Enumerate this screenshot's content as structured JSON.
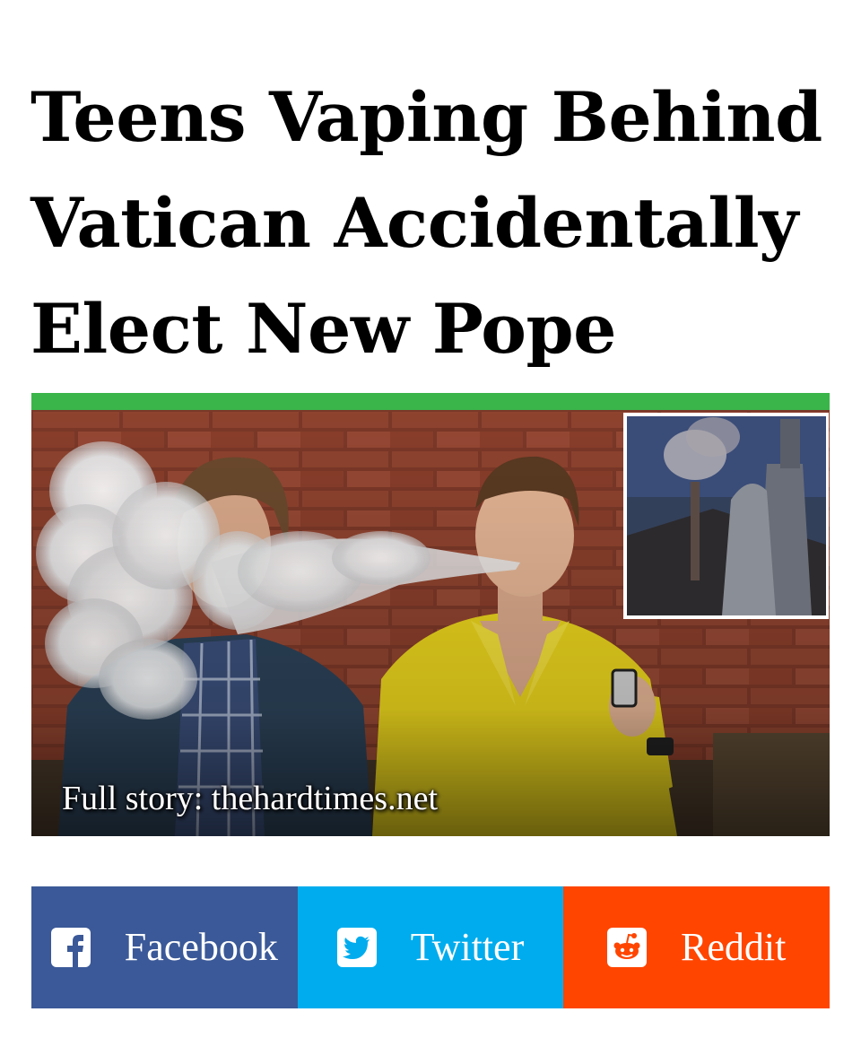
{
  "article": {
    "headline": "Teens Vaping Behind Vatican Accidentally Elect New Pope",
    "image_caption": "Full story: thehardtimes.net"
  },
  "share": {
    "facebook": {
      "label": "Facebook",
      "icon": "facebook-icon",
      "color": "#3b5998"
    },
    "twitter": {
      "label": "Twitter",
      "icon": "twitter-icon",
      "color": "#00aced"
    },
    "reddit": {
      "label": "Reddit",
      "icon": "reddit-icon",
      "color": "#ff4500"
    }
  },
  "colors": {
    "accent_bar": "#3ab54a",
    "text": "#000000"
  }
}
